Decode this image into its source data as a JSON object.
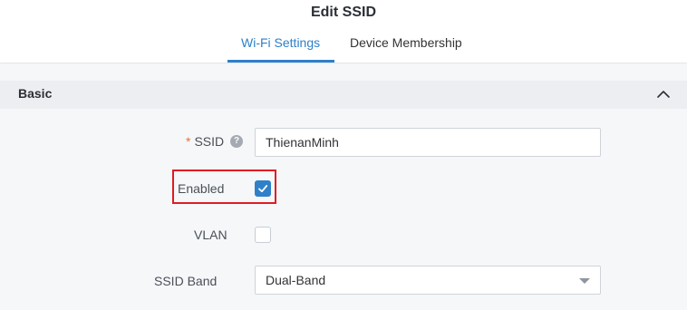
{
  "title": "Edit SSID",
  "tabs": [
    {
      "label": "Wi-Fi Settings",
      "active": true
    },
    {
      "label": "Device Membership",
      "active": false
    }
  ],
  "section": {
    "title": "Basic",
    "icon": "chevron-up-icon"
  },
  "form": {
    "ssid": {
      "required_mark": "*",
      "label": "SSID",
      "help_icon": "?",
      "value": "ThienanMinh"
    },
    "enabled": {
      "label": "Enabled",
      "checked": true
    },
    "vlan": {
      "label": "VLAN",
      "checked": false
    },
    "ssid_band": {
      "label": "SSID Band",
      "value": "Dual-Band"
    }
  },
  "colors": {
    "accent": "#2f80c9",
    "required": "#e8743b",
    "highlight": "#e01b24"
  }
}
